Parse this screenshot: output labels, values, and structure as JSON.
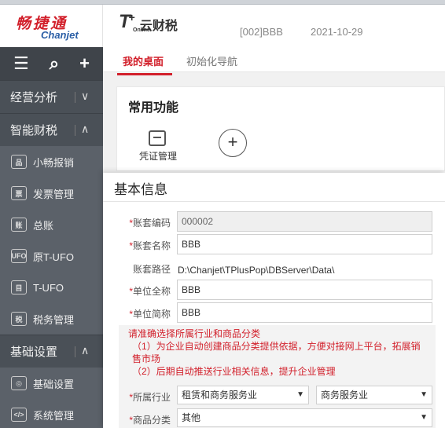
{
  "logo": {
    "cn": "畅捷通",
    "en": "Chanjet"
  },
  "header": {
    "brand_t": "T",
    "brand_plus": "+",
    "brand_online": "Online",
    "brand_name": "云财税",
    "account": "[002]BBB",
    "date": "2021-10-29"
  },
  "sidebar": {
    "tools": {
      "menu": "☰",
      "search": "⌕",
      "add": "+"
    },
    "groups": {
      "analysis": {
        "label": "经营分析",
        "chevron": "∨"
      },
      "finance": {
        "label": "智能财税",
        "chevron": "∧"
      },
      "basic": {
        "label": "基础设置",
        "chevron": "∧"
      }
    },
    "items": [
      {
        "label": "小畅报销",
        "icon": "reimburse-icon",
        "glyph": "品"
      },
      {
        "label": "发票管理",
        "icon": "invoice-icon",
        "glyph": "票"
      },
      {
        "label": "总账",
        "icon": "ledger-icon",
        "glyph": "账"
      },
      {
        "label": "原T-UFO",
        "icon": "ufo-icon",
        "glyph": "UFO"
      },
      {
        "label": "T-UFO",
        "icon": "tufo-icon",
        "glyph": "目"
      },
      {
        "label": "税务管理",
        "icon": "tax-icon",
        "glyph": "税"
      },
      {
        "label": "基础设置",
        "icon": "settings-icon",
        "glyph": "◎"
      },
      {
        "label": "系统管理",
        "icon": "system-icon",
        "glyph": "</>"
      }
    ]
  },
  "tabs": [
    {
      "label": "我的桌面",
      "active": true
    },
    {
      "label": "初始化导航",
      "active": false
    }
  ],
  "desktop": {
    "card_title": "常用功能",
    "function_label": "凭证管理",
    "add_symbol": "+"
  },
  "dialog": {
    "title": "基本信息",
    "fields": {
      "code_label": "账套编码",
      "code_value": "000002",
      "name_label": "账套名称",
      "name_value": "BBB",
      "path_label": "账套路径",
      "path_value": "D:\\Chanjet\\TPlusPop\\DBServer\\Data\\",
      "fullname_label": "单位全称",
      "fullname_value": "BBB",
      "shortname_label": "单位简称",
      "shortname_value": "BBB",
      "industry_label": "所属行业",
      "industry_value1": "租赁和商务服务业",
      "industry_value2": "商务服务业",
      "category_label": "商品分类",
      "category_value": "其他",
      "required_mark": "*"
    },
    "hint": {
      "line1": "请准确选择所属行业和商品分类",
      "line2": "（1）为企业自动创建商品分类提供依据，方便对接网上平台，拓展销售市场",
      "line3": "（2）后期自动推送行业相关信息，提升企业管理"
    }
  },
  "colors": {
    "accent": "#d2202b",
    "sidebar": "#555b63",
    "sidebar_dark": "#3f444a"
  }
}
